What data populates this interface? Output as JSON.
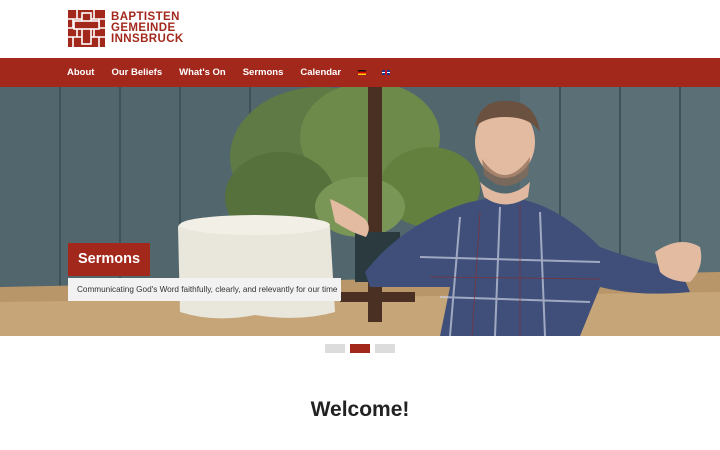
{
  "site": {
    "logo_lines": [
      "BAPTISTEN",
      "GEMEINDE",
      "INNSBRUCK"
    ],
    "brand_color": "#a3281c"
  },
  "nav": {
    "items": [
      {
        "label": "About"
      },
      {
        "label": "Our Beliefs"
      },
      {
        "label": "What's On"
      },
      {
        "label": "Sermons"
      },
      {
        "label": "Calendar"
      }
    ],
    "languages": [
      {
        "icon": "german-flag-icon"
      },
      {
        "icon": "uk-flag-icon"
      }
    ]
  },
  "hero": {
    "title": "Sermons",
    "subtitle": "Communicating God's Word faithfully, clearly, and relevantly for our time",
    "slide_count": 3,
    "active_slide": 2
  },
  "main": {
    "heading": "Welcome!"
  }
}
